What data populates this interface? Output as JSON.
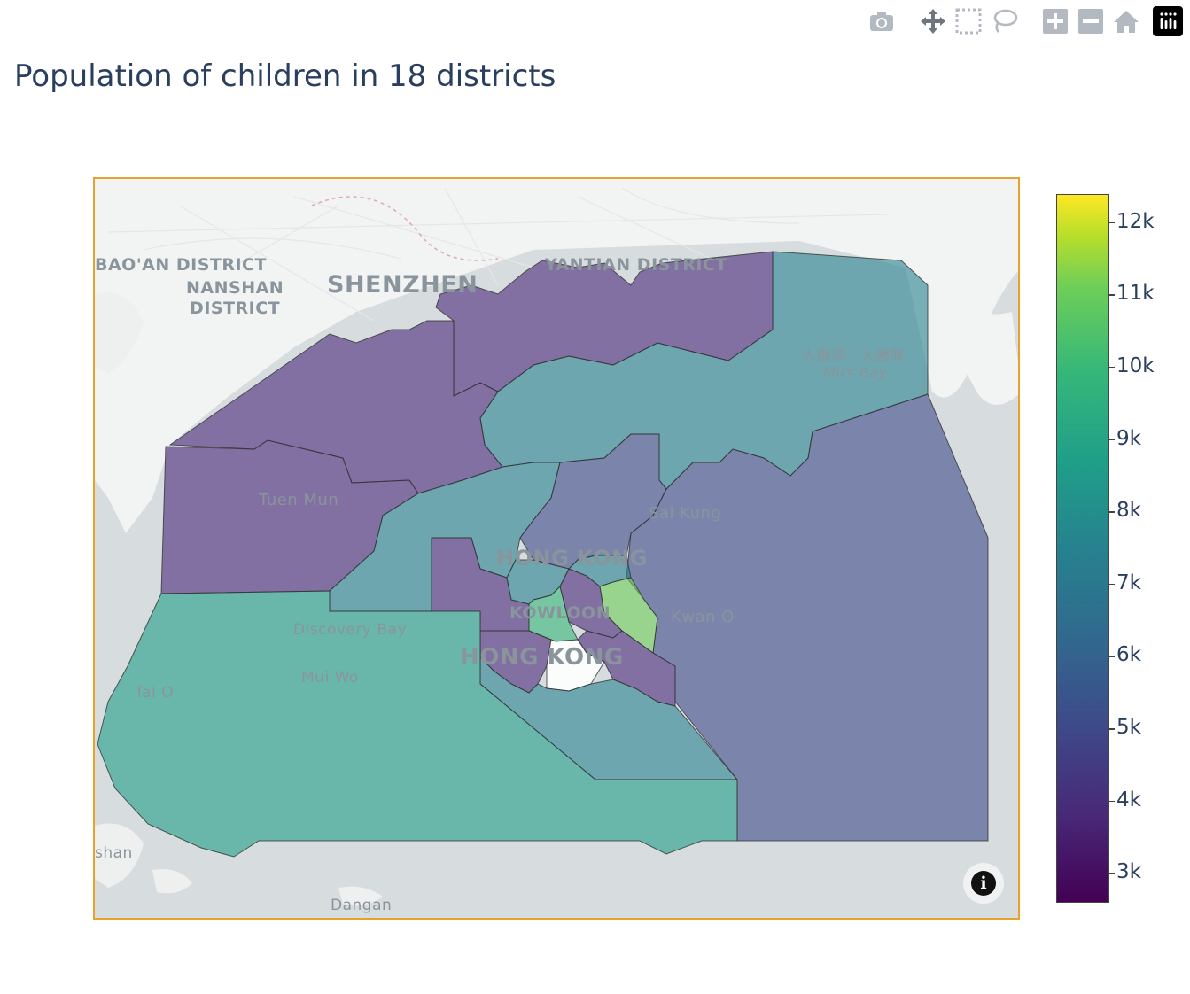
{
  "title": "Population of children in 18 districts",
  "modebar": [
    {
      "name": "camera-icon",
      "label": "Download plot as a png"
    },
    {
      "name": "pan-icon",
      "label": "Pan"
    },
    {
      "name": "box-select-icon",
      "label": "Box Select"
    },
    {
      "name": "lasso-select-icon",
      "label": "Lasso Select"
    },
    {
      "name": "zoom-in-icon",
      "label": "Zoom in"
    },
    {
      "name": "zoom-out-icon",
      "label": "Zoom out"
    },
    {
      "name": "home-icon",
      "label": "Reset view"
    },
    {
      "name": "plotly-logo-icon",
      "label": "Produced with Plotly"
    }
  ],
  "map": {
    "labels": {
      "baoan": "BAO'AN DISTRICT",
      "nanshan": "NANSHAN\nDISTRICT",
      "shenzhen": "SHENZHEN",
      "yantian": "YANTIAN DISTRICT",
      "mirs_cn": "大鵬湾 · 大鵬灣",
      "mirs": "Mirs Bay",
      "tuen_mun": "Tuen Mun",
      "sai_kung": "Sai Kung",
      "hong_kong_1": "HONG KONG",
      "kowloon": "KOWLOON",
      "kwan_o": "Kwan O",
      "discovery_bay": "Discovery Bay",
      "hong_kong_2": "HONG KONG",
      "mui_wo": "Mui Wo",
      "tai_o": "Tai O",
      "shan": "shan",
      "dangan": "Dangan"
    },
    "info_icon": "info-icon"
  },
  "colorbar": {
    "colorscale": "Viridis",
    "range": [
      2600,
      12400
    ],
    "ticks": [
      "12k",
      "11k",
      "10k",
      "9k",
      "8k",
      "7k",
      "6k",
      "5k",
      "4k",
      "3k"
    ],
    "colors": [
      "#440154",
      "#482878",
      "#3e4a89",
      "#31688e",
      "#26828e",
      "#1f9e89",
      "#35b779",
      "#6ece58",
      "#b5de2b",
      "#fde725"
    ]
  }
}
